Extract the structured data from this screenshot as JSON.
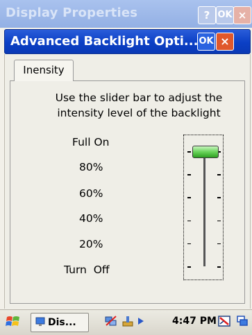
{
  "outer_window": {
    "title": "Display Properties",
    "help_label": "?",
    "ok_label": "OK",
    "close_label": "×"
  },
  "dialog": {
    "title": "Advanced Backlight Opti...",
    "ok_label": "OK",
    "close_label": "×"
  },
  "tab": {
    "label": "Inensity"
  },
  "instructions": {
    "line1": "Use the slider bar to adjust the",
    "line2": "intensity level of the backlight"
  },
  "levels": [
    "Full On",
    "80%",
    "60%",
    "40%",
    "20%",
    "Turn  Off"
  ],
  "slider": {
    "value_fraction": 1.0
  },
  "taskbar": {
    "task_label": "Dis...",
    "clock": "4:47 PM"
  },
  "colors": {
    "title_active": "#0b3fc5",
    "close_button": "#e0582c",
    "slider_thumb": "#69d35a"
  },
  "icons": [
    "windows-start-icon",
    "display-properties-icon",
    "network-icon",
    "arrow-icon",
    "keyboard-icon",
    "windows-icon"
  ]
}
